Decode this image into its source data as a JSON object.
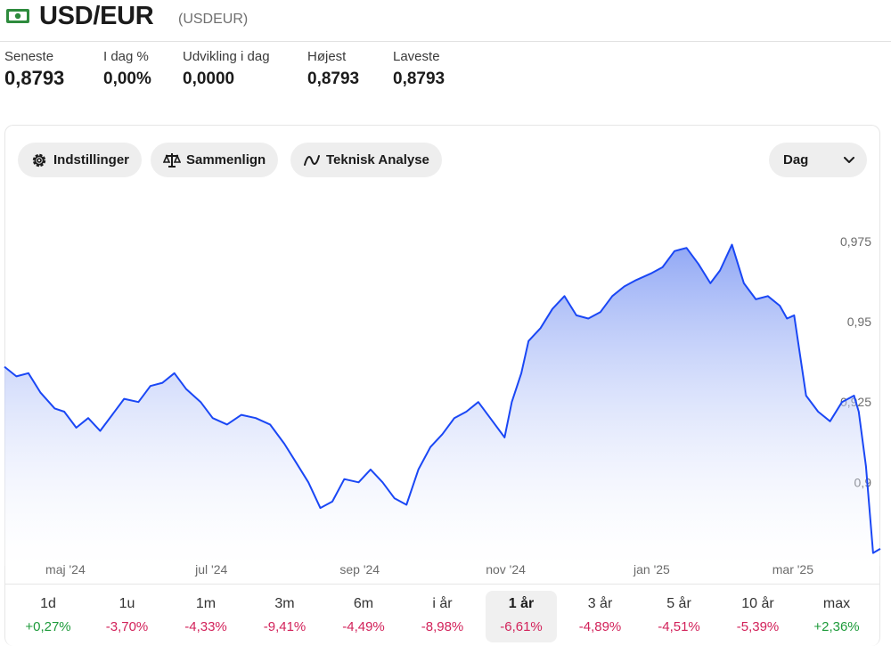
{
  "header": {
    "title": "USD/EUR",
    "ticker": "(USDEUR)"
  },
  "stats": [
    {
      "label": "Seneste",
      "value": "0,8793"
    },
    {
      "label": "I dag %",
      "value": "0,00%"
    },
    {
      "label": "Udvikling i dag",
      "value": "0,0000"
    },
    {
      "label": "Højest",
      "value": "0,8793"
    },
    {
      "label": "Laveste",
      "value": "0,8793"
    }
  ],
  "toolbar": {
    "settings_label": "Indstillinger",
    "compare_label": "Sammenlign",
    "analysis_label": "Teknisk Analyse",
    "interval_value": "Dag"
  },
  "colors": {
    "line": "#1a47f5",
    "positive": "#1d9a3a",
    "negative": "#d2225a"
  },
  "chart_data": {
    "type": "area",
    "x_ticks": [
      "maj '24",
      "jul '24",
      "sep '24",
      "nov '24",
      "jan '25",
      "mar '25"
    ],
    "y_ticks": [
      "0,975",
      "0,95",
      "0,925",
      "0,9"
    ],
    "y_tick_values": [
      0.975,
      0.95,
      0.925,
      0.9
    ],
    "ylim": [
      0.874,
      0.985
    ],
    "x_range": [
      "2024-04-10",
      "2025-04-11"
    ],
    "series": [
      {
        "x": [
          "2024-04-10",
          "2024-04-15",
          "2024-04-20",
          "2024-04-25",
          "2024-05-01",
          "2024-05-05",
          "2024-05-10",
          "2024-05-15",
          "2024-05-20",
          "2024-05-25",
          "2024-05-30",
          "2024-06-05",
          "2024-06-10",
          "2024-06-15",
          "2024-06-20",
          "2024-06-25",
          "2024-07-01",
          "2024-07-06",
          "2024-07-12",
          "2024-07-18",
          "2024-07-24",
          "2024-07-30",
          "2024-08-05",
          "2024-08-10",
          "2024-08-15",
          "2024-08-20",
          "2024-08-25",
          "2024-08-30",
          "2024-09-05",
          "2024-09-10",
          "2024-09-15",
          "2024-09-20",
          "2024-09-25",
          "2024-09-30",
          "2024-10-05",
          "2024-10-10",
          "2024-10-15",
          "2024-10-20",
          "2024-10-25",
          "2024-10-30",
          "2024-11-05",
          "2024-11-08",
          "2024-11-12",
          "2024-11-15",
          "2024-11-20",
          "2024-11-25",
          "2024-11-30",
          "2024-12-05",
          "2024-12-10",
          "2024-12-15",
          "2024-12-20",
          "2024-12-25",
          "2024-12-30",
          "2025-01-05",
          "2025-01-10",
          "2025-01-15",
          "2025-01-20",
          "2025-01-25",
          "2025-01-30",
          "2025-02-03",
          "2025-02-08",
          "2025-02-13",
          "2025-02-18",
          "2025-02-23",
          "2025-02-28",
          "2025-03-03",
          "2025-03-06",
          "2025-03-11",
          "2025-03-16",
          "2025-03-21",
          "2025-03-26",
          "2025-03-31",
          "2025-04-02",
          "2025-04-05",
          "2025-04-08",
          "2025-04-11"
        ],
        "y": [
          0.936,
          0.933,
          0.934,
          0.928,
          0.923,
          0.922,
          0.917,
          0.92,
          0.916,
          0.921,
          0.926,
          0.925,
          0.93,
          0.931,
          0.934,
          0.929,
          0.925,
          0.92,
          0.918,
          0.921,
          0.92,
          0.918,
          0.912,
          0.906,
          0.9,
          0.892,
          0.894,
          0.901,
          0.9,
          0.904,
          0.9,
          0.895,
          0.893,
          0.904,
          0.911,
          0.915,
          0.92,
          0.922,
          0.925,
          0.92,
          0.914,
          0.925,
          0.934,
          0.944,
          0.948,
          0.954,
          0.958,
          0.952,
          0.951,
          0.953,
          0.958,
          0.961,
          0.963,
          0.965,
          0.967,
          0.972,
          0.973,
          0.968,
          0.962,
          0.966,
          0.974,
          0.962,
          0.957,
          0.958,
          0.955,
          0.951,
          0.952,
          0.927,
          0.922,
          0.919,
          0.925,
          0.927,
          0.922,
          0.905,
          0.878,
          0.8793
        ]
      }
    ]
  },
  "ranges": [
    {
      "label": "1d",
      "change": "+0,27%",
      "dir": "pos"
    },
    {
      "label": "1u",
      "change": "-3,70%",
      "dir": "neg"
    },
    {
      "label": "1m",
      "change": "-4,33%",
      "dir": "neg"
    },
    {
      "label": "3m",
      "change": "-9,41%",
      "dir": "neg"
    },
    {
      "label": "6m",
      "change": "-4,49%",
      "dir": "neg"
    },
    {
      "label": "i år",
      "change": "-8,98%",
      "dir": "neg"
    },
    {
      "label": "1 år",
      "change": "-6,61%",
      "dir": "neg",
      "active": true
    },
    {
      "label": "3 år",
      "change": "-4,89%",
      "dir": "neg"
    },
    {
      "label": "5 år",
      "change": "-4,51%",
      "dir": "neg"
    },
    {
      "label": "10 år",
      "change": "-5,39%",
      "dir": "neg"
    },
    {
      "label": "max",
      "change": "+2,36%",
      "dir": "pos"
    }
  ]
}
